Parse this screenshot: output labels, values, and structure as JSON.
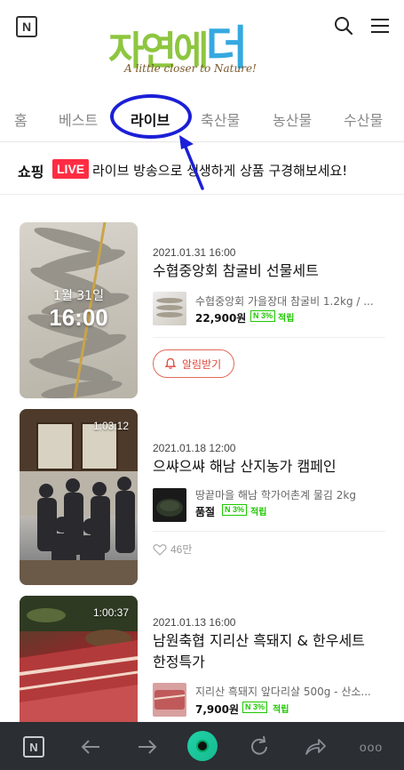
{
  "header": {
    "logo_label": "N",
    "brand_main_a": "자연에",
    "brand_main_b": "더",
    "brand_sub": "A little closer to Nature!"
  },
  "tabs": [
    "홈",
    "베스트",
    "라이브",
    "축산물",
    "농산물",
    "수산물"
  ],
  "active_tab": "라이브",
  "banner": {
    "shop": "쇼핑",
    "live": "LIVE",
    "text": "라이브 방송으로 생생하게 상품 구경해보세요!"
  },
  "items": [
    {
      "thumb_date": "1월 31일",
      "thumb_time": "16:00",
      "date": "2021.01.31 16:00",
      "title": "수협중앙회 참굴비 선물세트",
      "product_name": "수협중앙회 가을장대 참굴비 1.2kg / ...",
      "price": "22,900원",
      "npay_pct": "3%",
      "earn": "적립",
      "alarm": "알림받기"
    },
    {
      "duration": "1:03:12",
      "date": "2021.01.18 12:00",
      "title": "으쌰으쌰 해남 산지농가 캠페인",
      "product_name": "땅끝마을 해남 학가어촌계 물김 2kg",
      "price": "품절",
      "npay_pct": "3%",
      "earn": "적립",
      "likes": "46만"
    },
    {
      "duration": "1:00:37",
      "date": "2021.01.13 16:00",
      "title_line1": "남원축협 지리산 흑돼지 & 한우세트",
      "title_line2": "한정특가",
      "product_name": "지리산 흑돼지 앞다리살 500g - 산소...",
      "price": "7,900원",
      "npay_pct": "3%",
      "earn": "적립"
    }
  ],
  "bottom_bar": {
    "n_label": "N",
    "more_label": "ooo"
  },
  "colors": {
    "live_red": "#ff2c43",
    "npay_green": "#1ec800",
    "annotation_blue": "#1b1fd6",
    "bottom_bar": "#2b2e33"
  }
}
